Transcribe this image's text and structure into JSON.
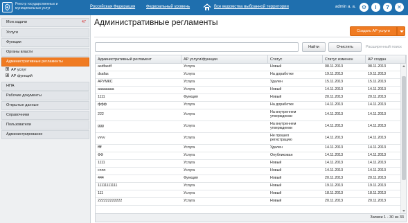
{
  "header": {
    "registry_title": "Реестр государственных и муниципальных услуг",
    "region_link": "Российская Федерация",
    "level_link": "Федеральный уровень",
    "territory_link": "Все ведомства выбранной территории",
    "user": "admin a. a.",
    "icons": [
      "gear-icon",
      "info-icon",
      "help-icon",
      "close-icon"
    ],
    "brand_color": "#1f6fae"
  },
  "sidebar": {
    "items": [
      {
        "label": "Мои задачи",
        "badge": "47"
      },
      {
        "label": "Услуги"
      },
      {
        "label": "Функции"
      },
      {
        "label": "Органы власти"
      },
      {
        "label": "Административные регламенты",
        "active": true
      },
      {
        "label": "НПА"
      },
      {
        "label": "Рабочие документы"
      },
      {
        "label": "Открытые данные"
      },
      {
        "label": "Справочники"
      },
      {
        "label": "Пользователи"
      },
      {
        "label": "Администрирование"
      }
    ],
    "subitems": [
      {
        "label": "АР услуг"
      },
      {
        "label": "АР функций"
      }
    ],
    "accent_color": "#f07b22"
  },
  "main": {
    "title": "Административные регламенты",
    "create_button": "Создать АР услуги",
    "search": {
      "value": "",
      "placeholder": ""
    },
    "find_button": "Найти",
    "clear_button": "Очистить",
    "advanced_search": "Расширенный поиск"
  },
  "table": {
    "columns": [
      "Административный регламент",
      "АР услуги/функции",
      "Статус",
      "Статус изменен",
      "АР создан"
    ],
    "rows": [
      [
        "asdfasdf",
        "Услуга",
        "Новый",
        "08.11.2013",
        "08.11.2013"
      ],
      [
        "dsafas",
        "Услуга",
        "На доработке",
        "19.11.2013",
        "19.11.2013"
      ],
      [
        "АРУМКС",
        "Услуга",
        "Удален",
        "15.11.2013",
        "15.11.2013"
      ],
      [
        "аааааааа",
        "Услуга",
        "Новый",
        "14.11.2013",
        "14.11.2013"
      ],
      [
        "1111",
        "Функция",
        "Новый",
        "20.11.2013",
        "20.11.2013"
      ],
      [
        "ффф",
        "Услуга",
        "На доработке",
        "14.11.2013",
        "14.11.2013"
      ],
      [
        "222",
        "Услуга",
        "На внутреннем утверждении",
        "14.11.2013",
        "14.11.2013"
      ],
      [
        "ggg",
        "Услуга",
        "На внутреннем утверждении",
        "14.11.2013",
        "14.11.2013"
      ],
      [
        "vvvv",
        "Услуга",
        "Не прошел регистрацию",
        "14.11.2013",
        "14.11.2013"
      ],
      [
        "ffff",
        "Услуга",
        "Удален",
        "14.11.2013",
        "14.11.2013"
      ],
      [
        "ФФ",
        "Услуга",
        "Опубликован",
        "14.11.2013",
        "14.11.2013"
      ],
      [
        "1111",
        "Услуга",
        "Новый",
        "14.11.2013",
        "14.11.2013"
      ],
      [
        "cnnn",
        "Услуга",
        "Новый",
        "14.11.2013",
        "14.11.2013"
      ],
      [
        "444",
        "Функция",
        "Новый",
        "20.11.2013",
        "20.11.2013"
      ],
      [
        "11111111111",
        "Услуга",
        "Новый",
        "19.11.2013",
        "19.11.2013"
      ],
      [
        "111",
        "Услуга",
        "Новый",
        "18.11.2013",
        "18.11.2013"
      ],
      [
        "222222222222",
        "Услуга",
        "Новый",
        "20.11.2013",
        "20.11.2013"
      ]
    ]
  },
  "footer": {
    "records": "Записи 1 - 30 из 33"
  }
}
